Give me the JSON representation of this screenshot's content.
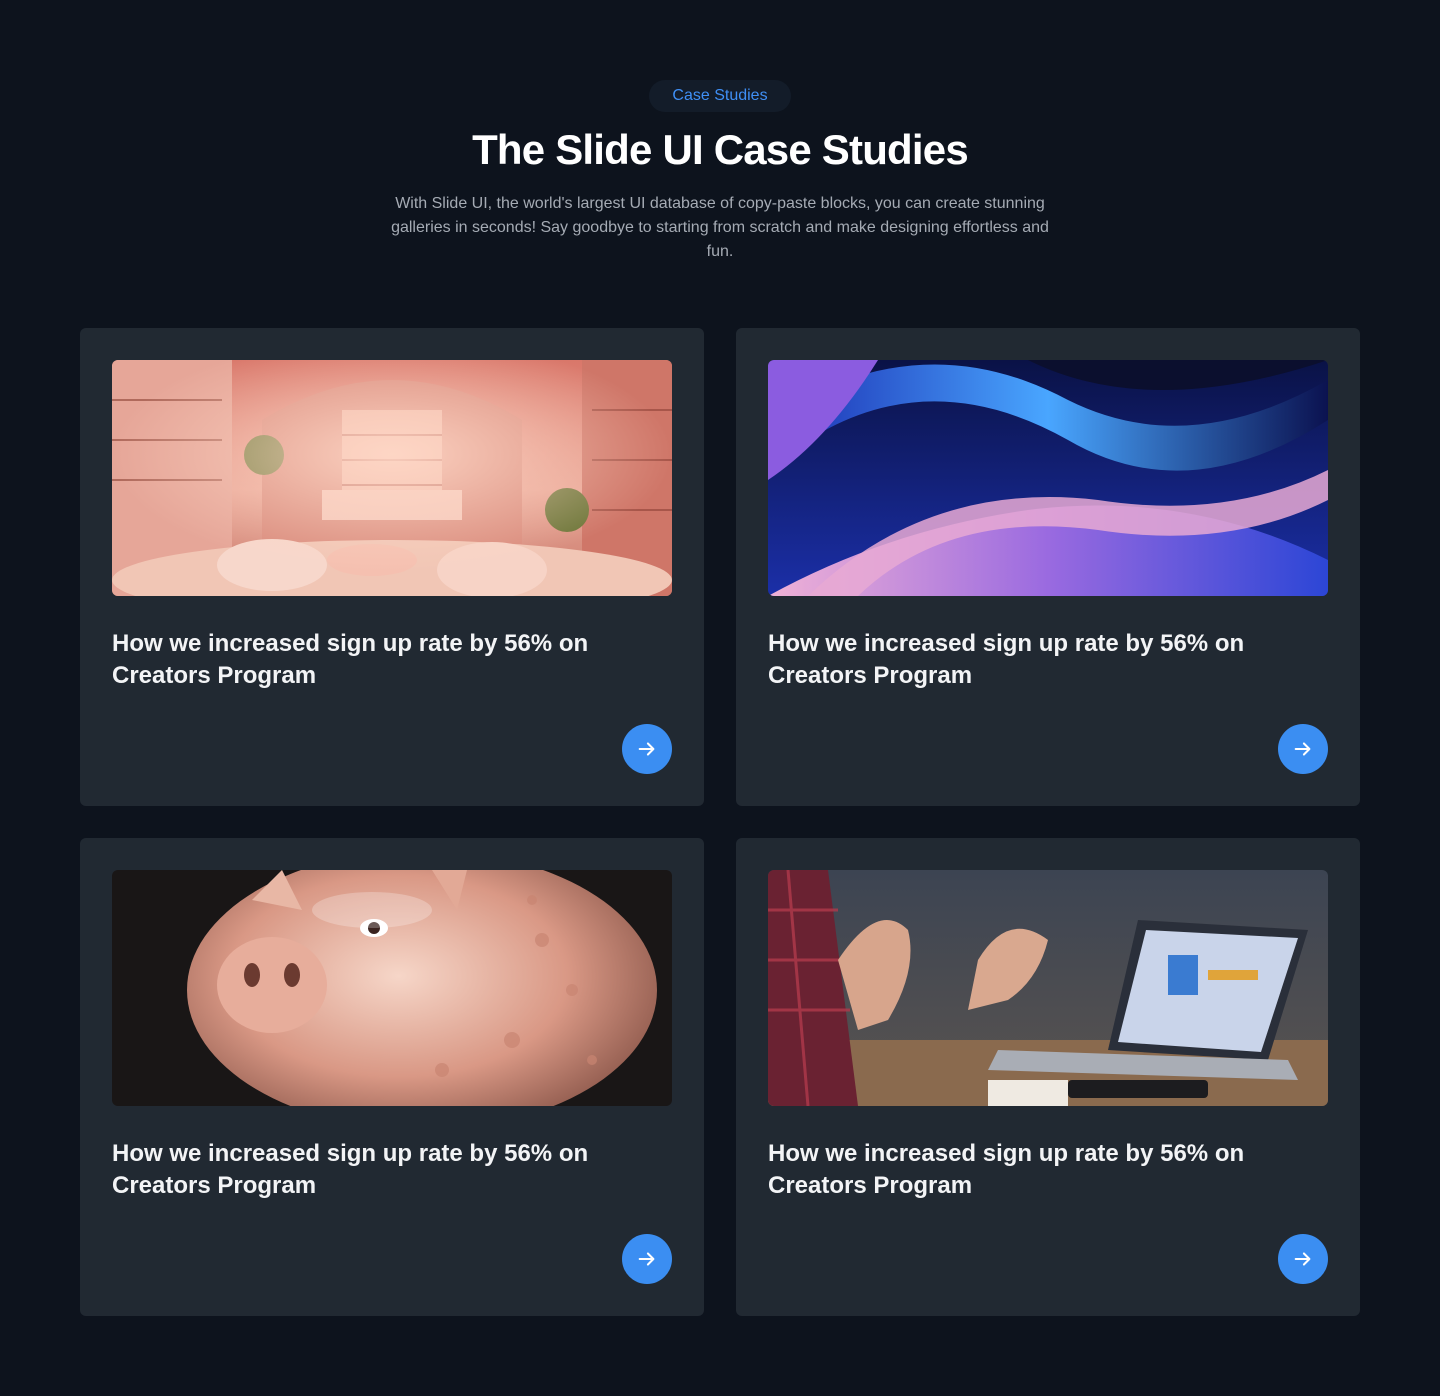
{
  "header": {
    "badge": "Case Studies",
    "title": "The Slide UI Case Studies",
    "subtitle": "With Slide UI, the world's largest UI database of copy-paste blocks, you can create stunning galleries in seconds! Say goodbye to starting from scratch and make designing effortless and fun."
  },
  "cards": [
    {
      "title": "How we increased sign up rate by 56% on Creators Program",
      "image": "pink-boutique-interior-photo",
      "button_icon": "arrow-right-icon"
    },
    {
      "title": "How we increased sign up rate by 56% on Creators Program",
      "image": "abstract-blue-waves-photo",
      "button_icon": "arrow-right-icon"
    },
    {
      "title": "How we increased sign up rate by 56% on Creators Program",
      "image": "glass-piggy-bank-photo",
      "button_icon": "arrow-right-icon"
    },
    {
      "title": "How we increased sign up rate by 56% on Creators Program",
      "image": "laptop-meeting-hands-photo",
      "button_icon": "arrow-right-icon"
    }
  ],
  "colors": {
    "background": "#0d131d",
    "card": "#212932",
    "accent": "#3b8ef2",
    "badge_text": "#3f8ff5"
  }
}
